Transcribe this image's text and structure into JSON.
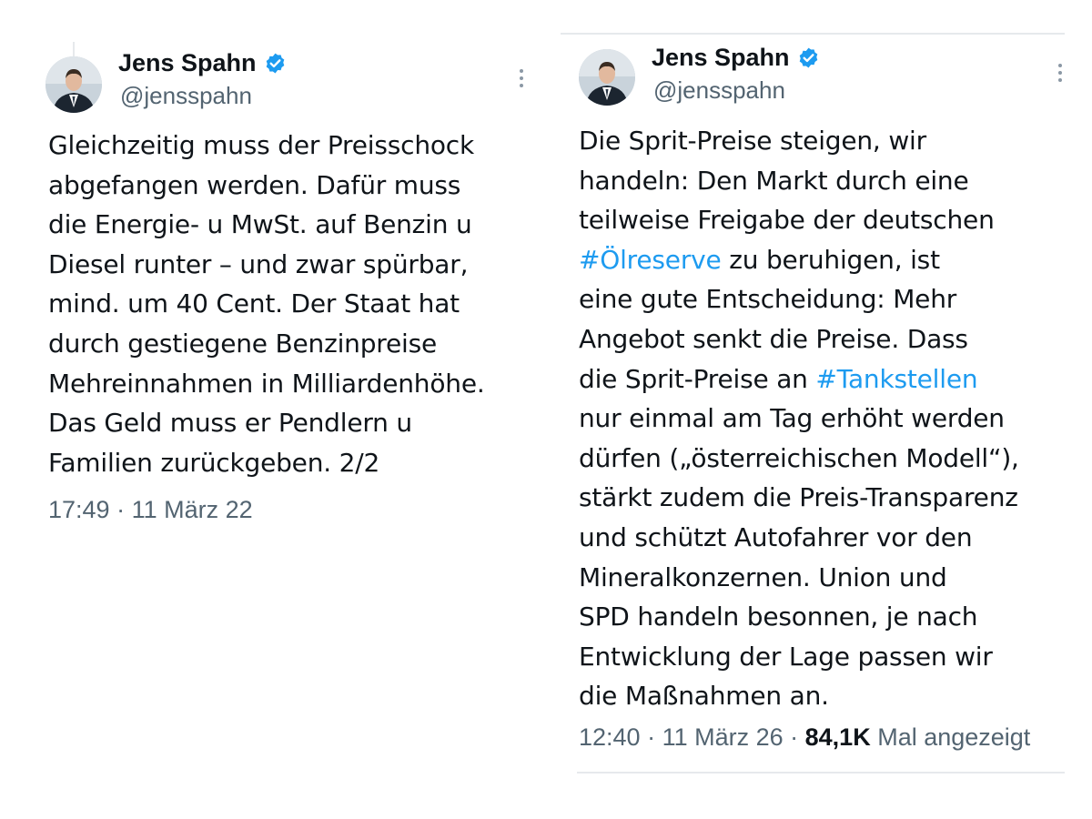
{
  "colors": {
    "text": "#0f1419",
    "secondary": "#536471",
    "link": "#1d9bf0",
    "verified_badge": "#1d9bf0"
  },
  "tweets": [
    {
      "author": {
        "name": "Jens Spahn",
        "handle": "@jensspahn",
        "verified_icon": "verified-badge-icon"
      },
      "more_icon": "more-dots-icon",
      "lines": [
        [
          {
            "t": "Gleichzeitig muss der Preisschock"
          }
        ],
        [
          {
            "t": "abgefangen werden. Dafür muss"
          }
        ],
        [
          {
            "t": "die Energie- u MwSt. auf Benzin u"
          }
        ],
        [
          {
            "t": "Diesel runter – und zwar spürbar,"
          }
        ],
        [
          {
            "t": "mind. um 40 Cent. Der Staat hat"
          }
        ],
        [
          {
            "t": "durch gestiegene Benzinpreise"
          }
        ],
        [
          {
            "t": "Mehreinnahmen in Milliardenhöhe."
          }
        ],
        [
          {
            "t": "Das Geld muss er Pendlern u"
          }
        ],
        [
          {
            "t": "Familien zurückgeben. 2/2"
          }
        ]
      ],
      "time": "17:49",
      "separator": " · ",
      "date": "11 März 22"
    },
    {
      "author": {
        "name": "Jens Spahn",
        "handle": "@jensspahn",
        "verified_icon": "verified-badge-icon"
      },
      "more_icon": "more-dots-icon",
      "lines": [
        [
          {
            "t": "Die Sprit-Preise steigen, wir"
          }
        ],
        [
          {
            "t": "handeln: Den Markt durch eine"
          }
        ],
        [
          {
            "t": "teilweise Freigabe der deutschen"
          }
        ],
        [
          {
            "t": "#Ölreserve",
            "link": true
          },
          {
            "t": " zu beruhigen, ist"
          }
        ],
        [
          {
            "t": "eine gute Entscheidung: Mehr"
          }
        ],
        [
          {
            "t": "Angebot senkt die Preise. Dass"
          }
        ],
        [
          {
            "t": "die Sprit-Preise an "
          },
          {
            "t": "#Tankstellen",
            "link": true
          }
        ],
        [
          {
            "t": "nur einmal am Tag erhöht werden"
          }
        ],
        [
          {
            "t": "dürfen („österreichischen Modell“),"
          }
        ],
        [
          {
            "t": "stärkt zudem die Preis-Transparenz"
          }
        ],
        [
          {
            "t": "und schützt Autofahrer vor den"
          }
        ],
        [
          {
            "t": "Mineralkonzernen. Union und"
          }
        ],
        [
          {
            "t": "SPD handeln besonnen, je nach"
          }
        ],
        [
          {
            "t": "Entwicklung der Lage passen wir"
          }
        ],
        [
          {
            "t": "die Maßnahmen an."
          }
        ]
      ],
      "time": "12:40",
      "separator": " · ",
      "date": "11 März 26",
      "separator2": " · ",
      "views": "84,1K",
      "views_label": " Mal angezeigt"
    }
  ]
}
